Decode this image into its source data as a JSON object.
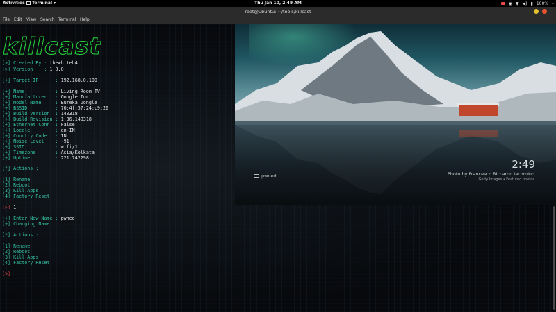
{
  "topbar": {
    "activities": "Activities",
    "app": "Terminal",
    "clock": "Thu Jan 10,  2:49 AM",
    "battery": "100%"
  },
  "window": {
    "title": "root@ubuntu: ~/tools/killcast",
    "menu": [
      "File",
      "Edit",
      "View",
      "Search",
      "Terminal",
      "Help"
    ]
  },
  "terminal": {
    "logo_text": "killcast",
    "created_by_label": "Created By",
    "created_by": "thewhiteh4t",
    "version_label": "Version",
    "version": "1.0.0",
    "target_label": "Target IP",
    "target_ip": "192.168.0.100",
    "info": [
      {
        "k": "Name",
        "v": "Living Room TV"
      },
      {
        "k": "Manufacturer",
        "v": "Google Inc."
      },
      {
        "k": "Model Name",
        "v": "Eureka Dongle"
      },
      {
        "k": "BSSID",
        "v": "70:4f:57:24:c9:20"
      },
      {
        "k": "Build Version",
        "v": "140318"
      },
      {
        "k": "Build Revision",
        "v": "1.36.140318"
      },
      {
        "k": "Ethernet Conn.",
        "v": "False"
      },
      {
        "k": "Locale",
        "v": "en-IN"
      },
      {
        "k": "Country Code",
        "v": "IN"
      },
      {
        "k": "Noise Level",
        "v": "-91"
      },
      {
        "k": "SSID",
        "v": "wifi/1"
      },
      {
        "k": "Timezone",
        "v": "Asia/Kolkata"
      },
      {
        "k": "Uptime",
        "v": "221.742298"
      }
    ],
    "actions_label": "Actions :",
    "actions": [
      "Rename",
      "Reboot",
      "Kill Apps",
      "Factory Reset"
    ],
    "input1": "1",
    "enter_name_label": "Enter New Name",
    "new_name": "pwned",
    "changing": "Changing Name...",
    "actions2": [
      "Rename",
      "Reboot",
      "Kill Apps",
      "Factory Reset"
    ]
  },
  "cast": {
    "time": "2:49",
    "credit": "Photo by Francesco Riccardo Iacomino",
    "credit_sub": "Getty Images • Featured photos",
    "device_name": "pwned"
  },
  "colors": {
    "logo": "#26d63c",
    "prompt": "#35c2a6",
    "input_prompt": "#e04545"
  }
}
